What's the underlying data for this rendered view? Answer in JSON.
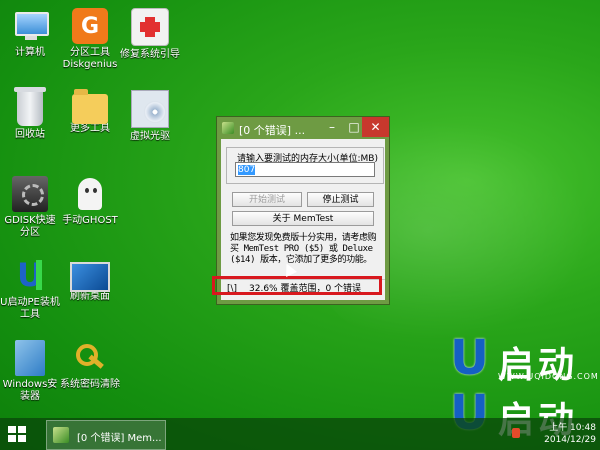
{
  "desktop": {
    "icons": [
      {
        "label": "计算机",
        "icon": "computer-icon"
      },
      {
        "label": "分区工具\nDiskgenius",
        "icon": "diskgenius-icon"
      },
      {
        "label": "修复系统引导",
        "icon": "repair-boot-icon"
      },
      {
        "label": "回收站",
        "icon": "recycle-bin-icon"
      },
      {
        "label": "更多工具",
        "icon": "folder-icon"
      },
      {
        "label": "虚拟光驱",
        "icon": "virtual-drive-icon"
      },
      {
        "label": "GDISK快速分区",
        "icon": "gdisk-icon"
      },
      {
        "label": "手动GHOST",
        "icon": "ghost-icon"
      },
      {
        "label": "U启动PE装机工具",
        "icon": "upe-install-icon"
      },
      {
        "label": "刷新桌面",
        "icon": "refresh-desktop-icon"
      },
      {
        "label": "Windows安装器",
        "icon": "windows-installer-icon"
      },
      {
        "label": "系统密码清除",
        "icon": "key-icon"
      }
    ]
  },
  "window": {
    "title": "[0 个错误] ...",
    "group_label": "请输入要测试的内存大小(单位:MB)",
    "input_value": "807",
    "start_label": "开始测试",
    "stop_label": "停止测试",
    "about_label": "关于 MemTest",
    "promo_text": "如果您发现免费版十分实用，请考虑购买 MemTest PRO ($5) 或 Deluxe ($14) 版本，它添加了更多的功能。",
    "status_spinner": "[\\]",
    "status_text": "32.6% 覆盖范围，0 个错误"
  },
  "brand": {
    "logo_text": "启动",
    "url": "WWW.UQIDONG.COM"
  },
  "taskbar": {
    "task_label": "[0 个错误] Mem...",
    "time": "上午 10:48",
    "date": "2014/12/29"
  },
  "colors": {
    "desktop": "#2aa61a",
    "window_frame": "#6e9b43",
    "highlight_box": "#d8181e",
    "close_button": "#c7382d"
  }
}
